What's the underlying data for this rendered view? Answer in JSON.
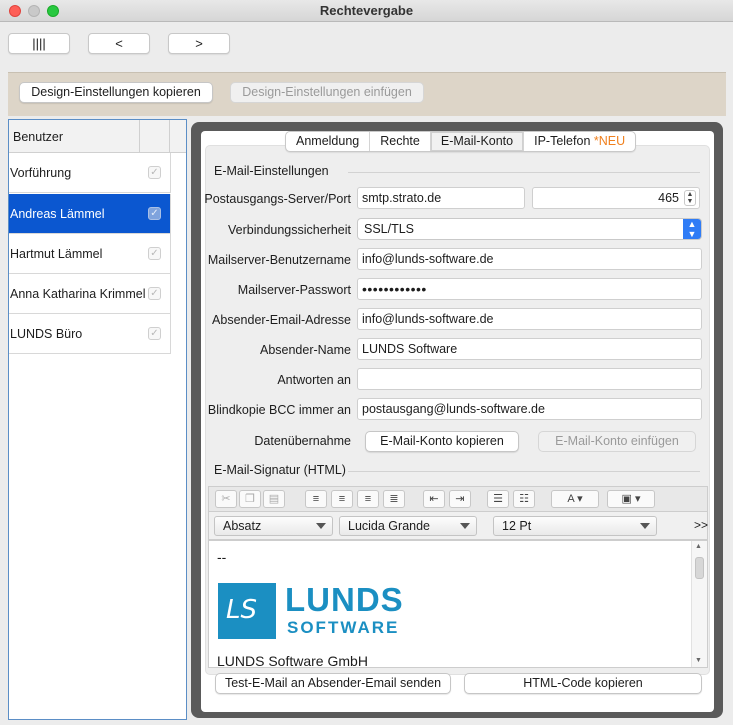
{
  "window": {
    "title": "Rechtevergabe"
  },
  "nav": {
    "list_label": "||||",
    "prev_label": "<",
    "next_label": ">"
  },
  "design": {
    "copy_label": "Design-Einstellungen kopieren",
    "paste_label": "Design-Einstellungen einfügen"
  },
  "users": {
    "header": "Benutzer",
    "rows": [
      {
        "name": "Vorführung",
        "checked": true
      },
      {
        "name": "Andreas Lämmel",
        "checked": true,
        "selected": true
      },
      {
        "name": "Hartmut Lämmel",
        "checked": true
      },
      {
        "name": "Anna Katharina Krimmel",
        "checked": true
      },
      {
        "name": "LUNDS Büro",
        "checked": true
      }
    ],
    "check_glyph": "✓"
  },
  "tabs": {
    "anmeldung": "Anmeldung",
    "rechte": "Rechte",
    "email": "E-Mail-Konto",
    "ip": "IP-Telefon",
    "ip_badge": "*NEU",
    "active": "E-Mail-Konto"
  },
  "email": {
    "section_title": "E-Mail-Einstellungen",
    "server_label": "Postausgangs-Server/Port",
    "server_value": "smtp.strato.de",
    "port_value": "465",
    "security_label": "Verbindungssicherheit",
    "security_value": "SSL/TLS",
    "username_label": "Mailserver-Benutzername",
    "username_value": "info@lunds-software.de",
    "password_label": "Mailserver-Passwort",
    "password_value": "••••••••••••",
    "sender_email_label": "Absender-Email-Adresse",
    "sender_email_value": "info@lunds-software.de",
    "sender_name_label": "Absender-Name",
    "sender_name_value": "LUNDS Software",
    "reply_label": "Antworten an",
    "reply_value": "",
    "bcc_label": "Blindkopie BCC immer an",
    "bcc_value": "postausgang@lunds-software.de",
    "transfer_label": "Datenübernahme",
    "copy_account": "E-Mail-Konto kopieren",
    "paste_account": "E-Mail-Konto einfügen"
  },
  "signature": {
    "section_title": "E-Mail-Signatur (HTML)",
    "paragraph_style": "Absatz",
    "font": "Lucida Grande",
    "size": "12 Pt",
    "more": ">>",
    "dash_line": "--",
    "logo_top": "LUNDS",
    "logo_bottom": "SOFTWARE",
    "logo_mark": "LS",
    "company_line": "LUNDS Software GmbH",
    "brand_color": "#1b8fc2"
  },
  "actions": {
    "test_mail": "Test-E-Mail an Absender-Email senden",
    "copy_html": "HTML-Code kopieren"
  }
}
